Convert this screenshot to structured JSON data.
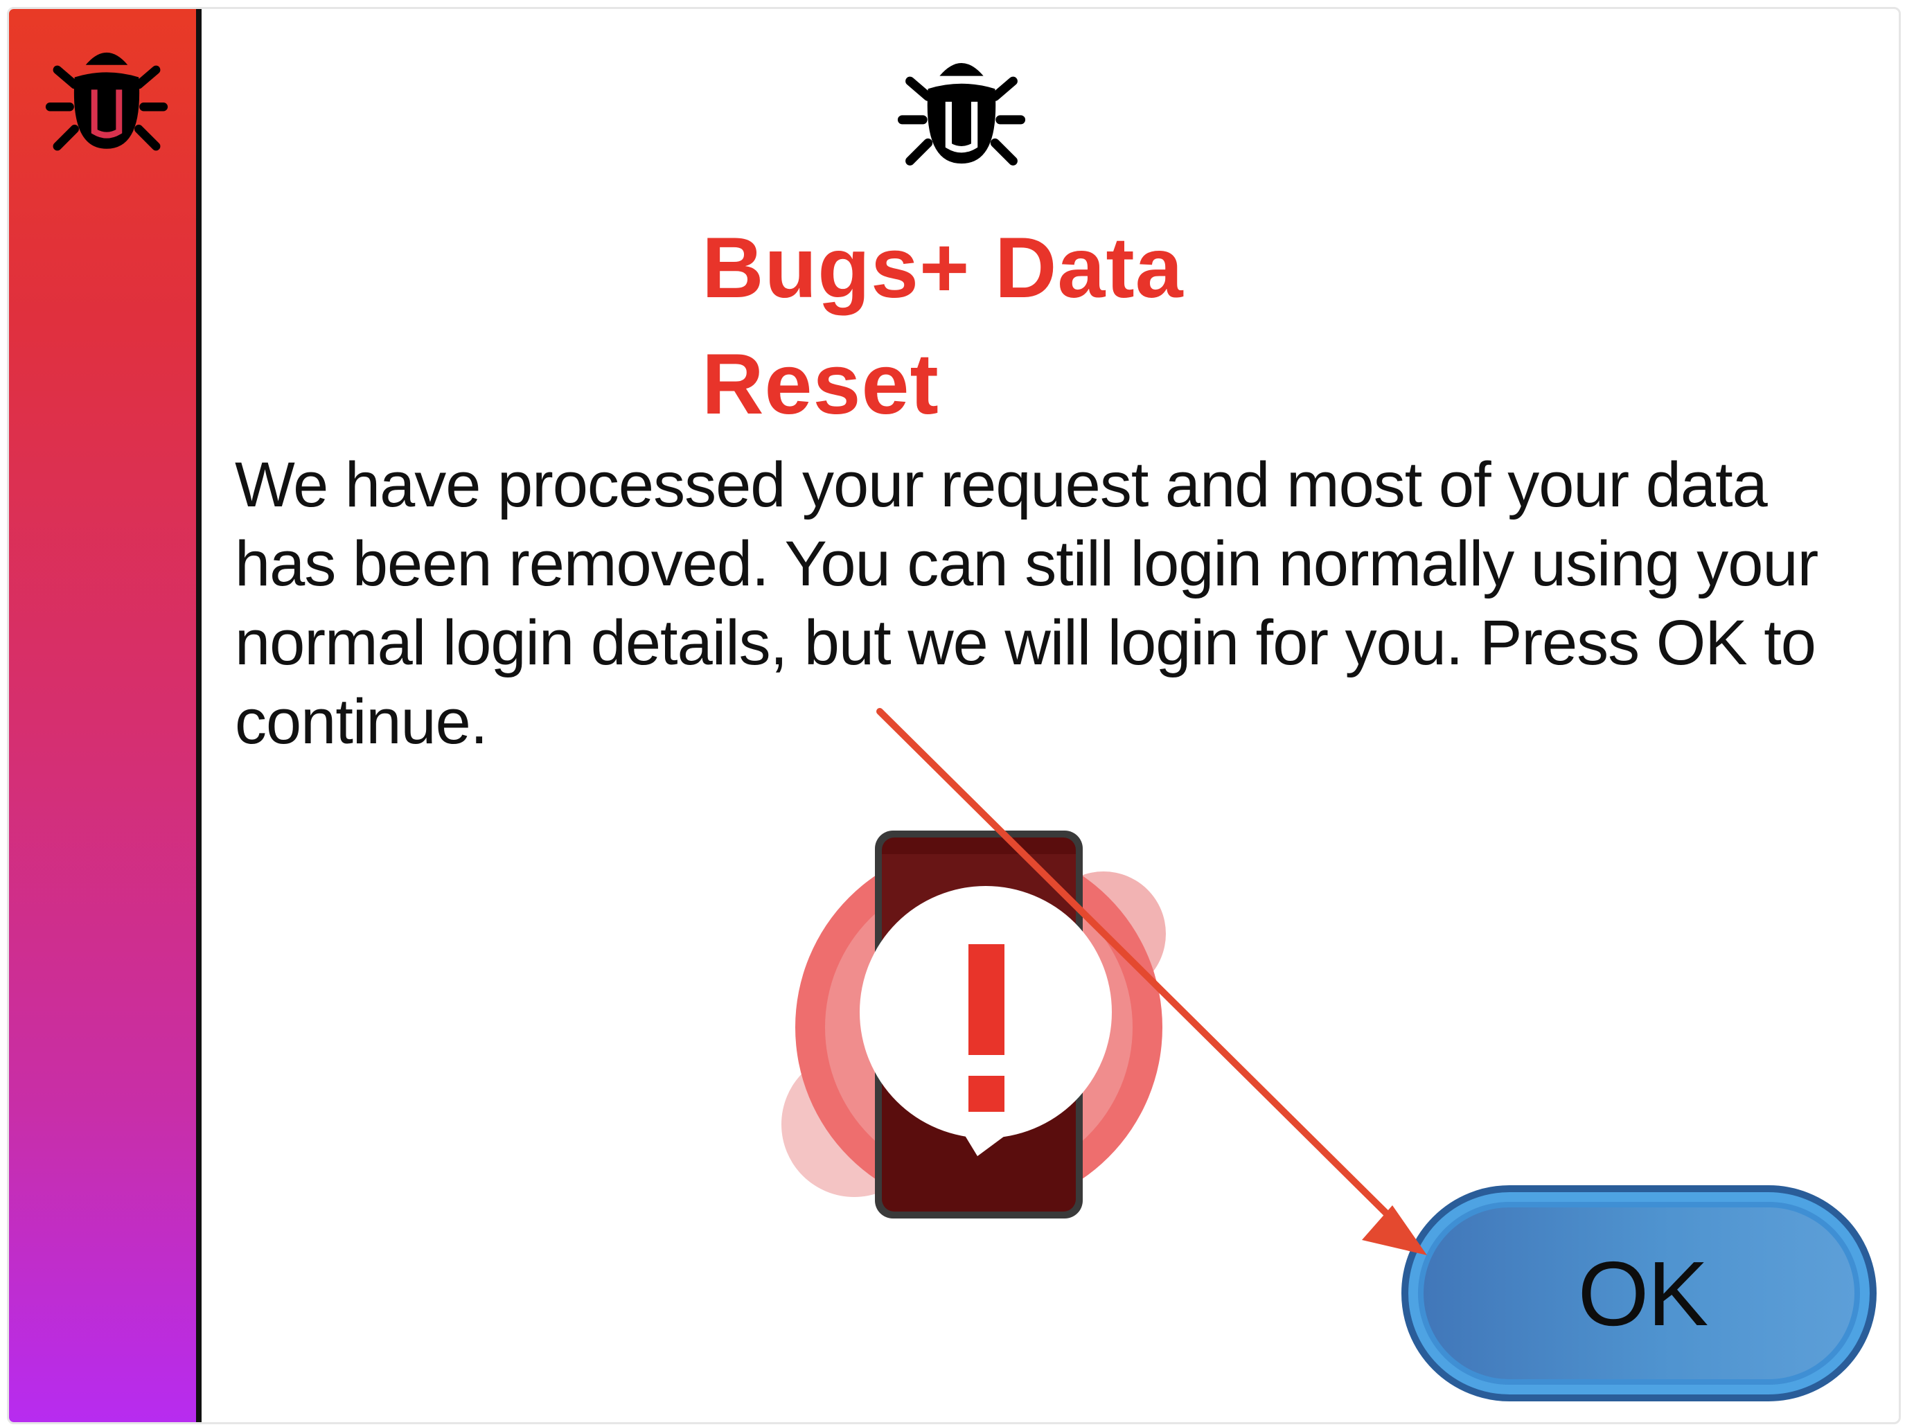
{
  "dialog": {
    "title_line_1": "Bugs+ Data",
    "title_line_2": "Reset",
    "message": "We have processed your request and most of your data has been removed. You can still login normally using your normal login details, but we will login for you. Press OK to continue.",
    "ok_label": "OK"
  },
  "icons": {
    "sidebar": "bug-icon",
    "header": "bug-icon",
    "illustration": "phone-alert-icon",
    "annotation": "red-arrow"
  },
  "colors": {
    "title": "#e8342a",
    "sidebar_top": "#e83a26",
    "sidebar_bottom": "#b72cf0",
    "button": "#4f93cf",
    "button_border": "#2a5d99",
    "arrow": "#e4492f"
  }
}
